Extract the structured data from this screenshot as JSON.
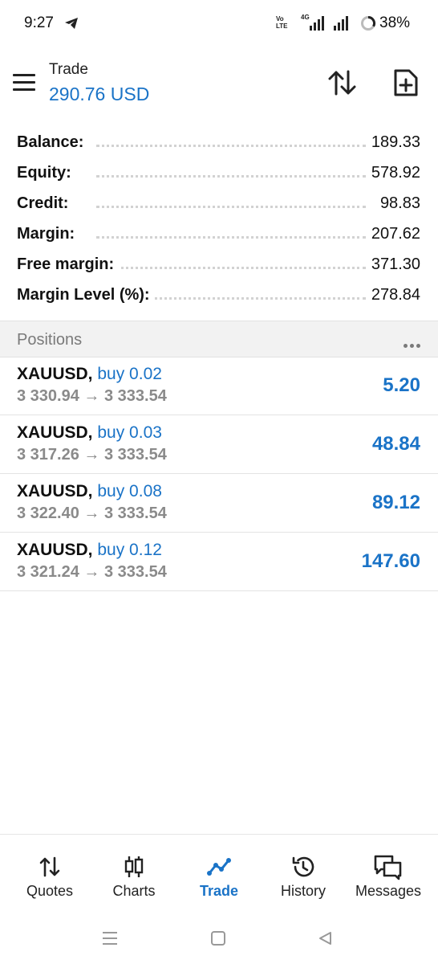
{
  "status_bar": {
    "time": "9:27",
    "volte": "Vo LTE",
    "network": "4G",
    "battery": "38%"
  },
  "header": {
    "title": "Trade",
    "balance_display": "290.76 USD"
  },
  "summary": [
    {
      "label": "Balance:",
      "value": "189.33"
    },
    {
      "label": "Equity:",
      "value": "578.92"
    },
    {
      "label": "Credit:",
      "value": "98.83"
    },
    {
      "label": "Margin:",
      "value": "207.62"
    },
    {
      "label": "Free margin:",
      "value": "371.30"
    },
    {
      "label": "Margin Level (%):",
      "value": "278.84"
    }
  ],
  "positions": {
    "title": "Positions",
    "items": [
      {
        "symbol": "XAUUSD,",
        "side": "buy 0.02",
        "prices": "3 330.94 → 3 333.54",
        "profit": "5.20"
      },
      {
        "symbol": "XAUUSD,",
        "side": "buy 0.03",
        "prices": "3 317.26 → 3 333.54",
        "profit": "48.84"
      },
      {
        "symbol": "XAUUSD,",
        "side": "buy 0.08",
        "prices": "3 322.40 → 3 333.54",
        "profit": "89.12"
      },
      {
        "symbol": "XAUUSD,",
        "side": "buy 0.12",
        "prices": "3 321.24 → 3 333.54",
        "profit": "147.60"
      }
    ]
  },
  "bottom_nav": {
    "active": "Trade",
    "items": [
      {
        "label": "Quotes",
        "icon": "quotes-icon"
      },
      {
        "label": "Charts",
        "icon": "charts-icon"
      },
      {
        "label": "Trade",
        "icon": "trade-icon"
      },
      {
        "label": "History",
        "icon": "history-icon"
      },
      {
        "label": "Messages",
        "icon": "messages-icon"
      }
    ]
  },
  "colors": {
    "accent": "#1a73c7",
    "section_bg": "#f2f2f2",
    "muted_text": "#8a8a8a"
  }
}
